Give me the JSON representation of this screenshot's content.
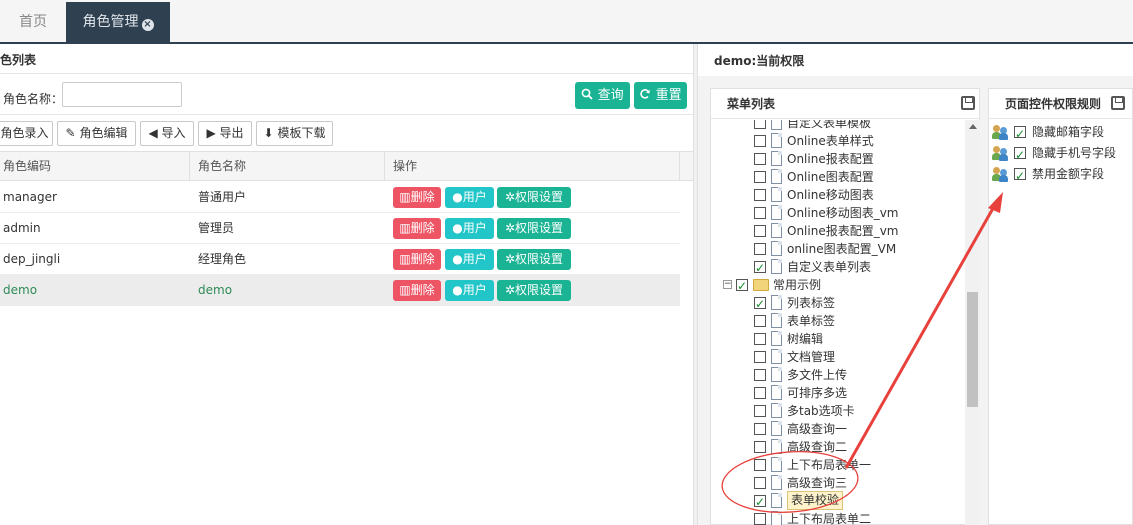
{
  "tabs": [
    {
      "label": "首页"
    },
    {
      "label": "角色管理",
      "close": "×"
    }
  ],
  "left": {
    "title": "色列表",
    "search_label": "角色名称：",
    "search_value": "",
    "query_label": "查询",
    "reset_label": "重置",
    "toolbar": [
      "角色录入",
      "角色编辑",
      "导入",
      "导出",
      "模板下载"
    ],
    "columns": [
      "角色编码",
      "角色名称",
      "操作"
    ],
    "rows": [
      {
        "code": "manager",
        "name": "普通用户"
      },
      {
        "code": "admin",
        "name": "管理员"
      },
      {
        "code": "dep_jingli",
        "name": "经理角色"
      },
      {
        "code": "demo",
        "name": "demo"
      }
    ],
    "row_actions": {
      "delete": "删除",
      "user": "用户",
      "perm": "权限设置"
    }
  },
  "right": {
    "title": "demo:当前权限",
    "menu_title": "菜单列表",
    "rules_title": "页面控件权限规则",
    "tree": [
      {
        "label": "自定义表单模板",
        "checked": false,
        "type": "file",
        "partial": true
      },
      {
        "label": "Online表单样式",
        "checked": false,
        "type": "file"
      },
      {
        "label": "Online报表配置",
        "checked": false,
        "type": "file"
      },
      {
        "label": "Online图表配置",
        "checked": false,
        "type": "file"
      },
      {
        "label": "Online移动图表",
        "checked": false,
        "type": "file"
      },
      {
        "label": "Online移动图表_vm",
        "checked": false,
        "type": "file"
      },
      {
        "label": "Online报表配置_vm",
        "checked": false,
        "type": "file"
      },
      {
        "label": "online图表配置_VM",
        "checked": false,
        "type": "file"
      },
      {
        "label": "自定义表单列表",
        "checked": true,
        "type": "file"
      },
      {
        "label": "常用示例",
        "checked": true,
        "type": "folder"
      },
      {
        "label": "列表标签",
        "checked": true,
        "type": "file"
      },
      {
        "label": "表单标签",
        "checked": false,
        "type": "file"
      },
      {
        "label": "树编辑",
        "checked": false,
        "type": "file"
      },
      {
        "label": "文档管理",
        "checked": false,
        "type": "file"
      },
      {
        "label": "多文件上传",
        "checked": false,
        "type": "file"
      },
      {
        "label": "可排序多选",
        "checked": false,
        "type": "file"
      },
      {
        "label": "多tab选项卡",
        "checked": false,
        "type": "file"
      },
      {
        "label": "高级查询一",
        "checked": false,
        "type": "file"
      },
      {
        "label": "高级查询二",
        "checked": false,
        "type": "file"
      },
      {
        "label": "上下布局表单一",
        "checked": false,
        "type": "file"
      },
      {
        "label": "高级查询三",
        "checked": false,
        "type": "file"
      },
      {
        "label": "表单校验",
        "checked": true,
        "type": "file",
        "highlight": true
      },
      {
        "label": "上下布局表单二",
        "checked": false,
        "type": "file"
      }
    ],
    "rules": [
      {
        "label": "隐藏邮箱字段",
        "checked": true
      },
      {
        "label": "隐藏手机号字段",
        "checked": true
      },
      {
        "label": "禁用金额字段",
        "checked": true
      }
    ]
  },
  "colors": {
    "primary": "#1ab394",
    "danger": "#ed5565",
    "info": "#23c6c8",
    "dark": "#2f4050",
    "annotation": "#e8413c"
  }
}
